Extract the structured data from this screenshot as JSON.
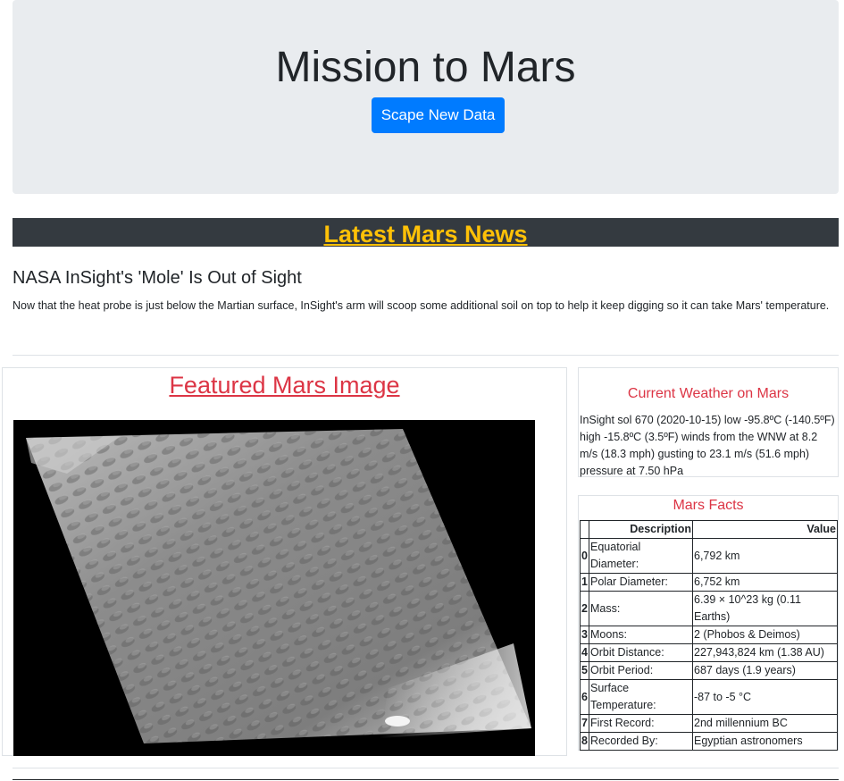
{
  "header": {
    "title": "Mission to Mars",
    "scrape_button_label": "Scape New Data"
  },
  "news": {
    "section_title": "Latest Mars News",
    "headline": "NASA InSight's 'Mole' Is Out of Sight",
    "paragraph": "Now that the heat probe is just below the Martian surface, InSight's arm will scoop some additional soil on top to help it keep digging so it can take Mars' temperature."
  },
  "featured": {
    "title": "Featured Mars Image"
  },
  "weather": {
    "title": "Current Weather on Mars",
    "text": "InSight sol 670 (2020-10-15) low -95.8ºC (-140.5ºF) high -15.8ºC (3.5ºF) winds from the WNW at 8.2 m/s (18.3 mph) gusting to 23.1 m/s (51.6 mph) pressure at 7.50 hPa"
  },
  "facts": {
    "title": "Mars Facts",
    "columns": [
      "Description",
      "Value"
    ],
    "rows": [
      {
        "idx": "0",
        "desc": "Equatorial Diameter:",
        "value": "6,792 km"
      },
      {
        "idx": "1",
        "desc": "Polar Diameter:",
        "value": "6,752 km"
      },
      {
        "idx": "2",
        "desc": "Mass:",
        "value": "6.39 × 10^23 kg (0.11 Earths)"
      },
      {
        "idx": "3",
        "desc": "Moons:",
        "value": "2 (Phobos & Deimos)"
      },
      {
        "idx": "4",
        "desc": "Orbit Distance:",
        "value": "227,943,824 km (1.38 AU)"
      },
      {
        "idx": "5",
        "desc": "Orbit Period:",
        "value": "687 days (1.9 years)"
      },
      {
        "idx": "6",
        "desc": "Surface Temperature:",
        "value": "-87 to -5 °C"
      },
      {
        "idx": "7",
        "desc": "First Record:",
        "value": "2nd millennium BC"
      },
      {
        "idx": "8",
        "desc": "Recorded By:",
        "value": "Egyptian astronomers"
      }
    ]
  },
  "colors": {
    "jumbotron_bg": "#e9ecef",
    "primary_button": "#007bff",
    "dark_bar": "#343a40",
    "warning_text": "#ffc107",
    "danger_text": "#dc3545"
  }
}
